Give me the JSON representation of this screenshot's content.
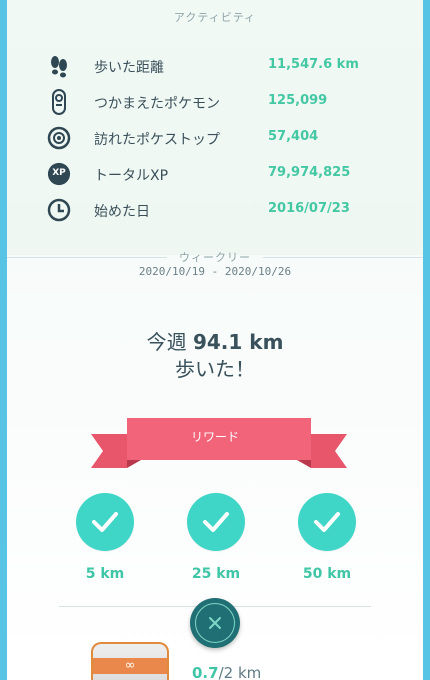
{
  "activity": {
    "header": "アクティビティ",
    "stats": [
      {
        "icon": "footprints-icon",
        "label": "歩いた距離",
        "value": "11,547.6 km"
      },
      {
        "icon": "pokeball-capsule-icon",
        "label": "つかまえたポケモン",
        "value": "125,099"
      },
      {
        "icon": "pokestop-icon",
        "label": "訪れたポケストップ",
        "value": "57,404"
      },
      {
        "icon": "xp-icon",
        "label": "トータルXP",
        "value": "79,974,825"
      },
      {
        "icon": "clock-icon",
        "label": "始めた日",
        "value": "2016/07/23"
      }
    ],
    "xp_badge": "XP"
  },
  "weekly": {
    "header": "ウィークリー",
    "date_range": "2020/10/19 - 2020/10/26",
    "message_prefix": "今週 ",
    "distance": "94.1 km",
    "message_suffix": "歩いた！"
  },
  "rewards": {
    "ribbon_label": "リワード",
    "milestones": [
      {
        "label": "5 km",
        "achieved": true
      },
      {
        "label": "25 km",
        "achieved": true
      },
      {
        "label": "50 km",
        "achieved": true
      }
    ]
  },
  "incubator": {
    "progress_current": "0.7",
    "progress_total": "/2 km"
  },
  "colors": {
    "accent_green": "#3fc6a6",
    "check_teal": "#3fd6c8",
    "ribbon_pink": "#f1647a",
    "close_button": "#1f6f74",
    "background_blue": "#57c4e6"
  }
}
